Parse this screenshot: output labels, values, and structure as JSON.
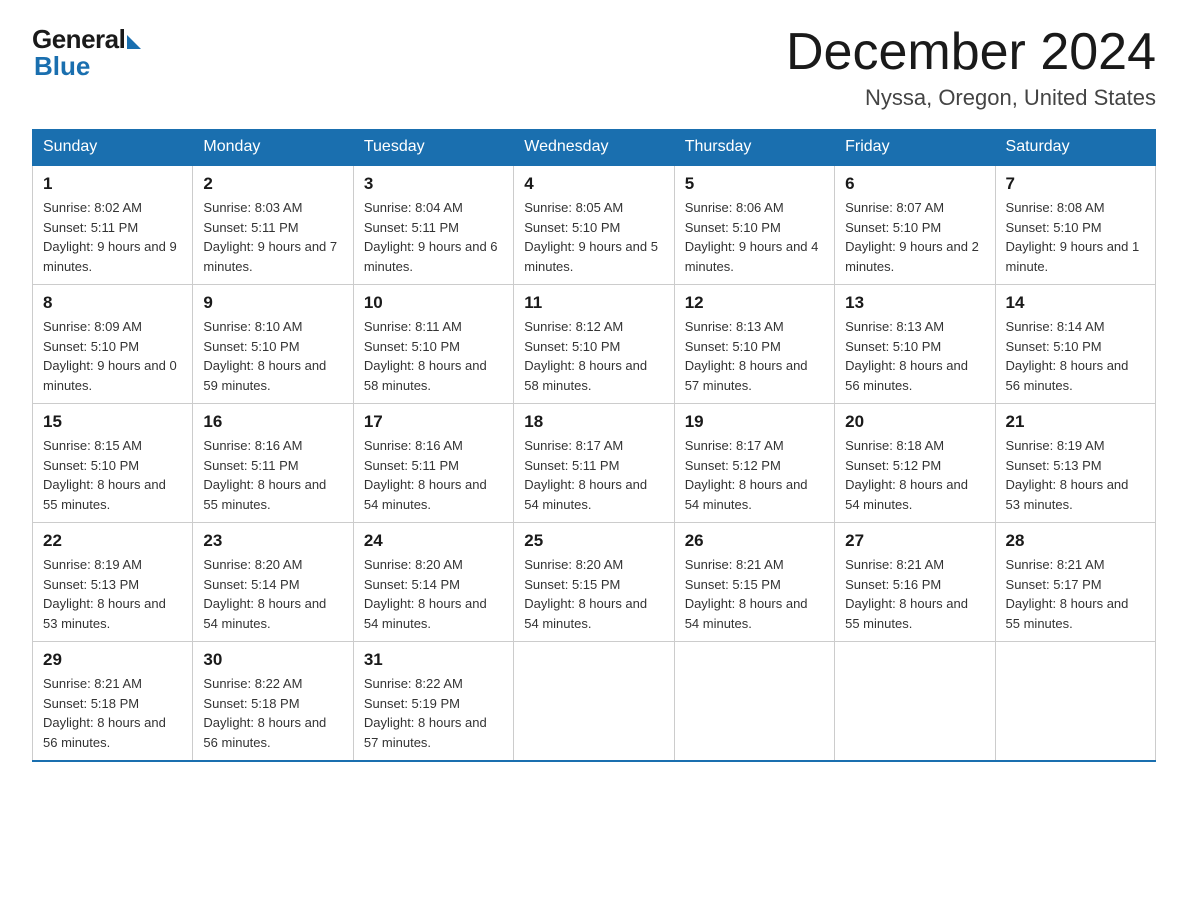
{
  "header": {
    "logo_general": "General",
    "logo_blue": "Blue",
    "month_title": "December 2024",
    "location": "Nyssa, Oregon, United States"
  },
  "days_of_week": [
    "Sunday",
    "Monday",
    "Tuesday",
    "Wednesday",
    "Thursday",
    "Friday",
    "Saturday"
  ],
  "weeks": [
    [
      {
        "day": "1",
        "sunrise": "8:02 AM",
        "sunset": "5:11 PM",
        "daylight": "9 hours and 9 minutes."
      },
      {
        "day": "2",
        "sunrise": "8:03 AM",
        "sunset": "5:11 PM",
        "daylight": "9 hours and 7 minutes."
      },
      {
        "day": "3",
        "sunrise": "8:04 AM",
        "sunset": "5:11 PM",
        "daylight": "9 hours and 6 minutes."
      },
      {
        "day": "4",
        "sunrise": "8:05 AM",
        "sunset": "5:10 PM",
        "daylight": "9 hours and 5 minutes."
      },
      {
        "day": "5",
        "sunrise": "8:06 AM",
        "sunset": "5:10 PM",
        "daylight": "9 hours and 4 minutes."
      },
      {
        "day": "6",
        "sunrise": "8:07 AM",
        "sunset": "5:10 PM",
        "daylight": "9 hours and 2 minutes."
      },
      {
        "day": "7",
        "sunrise": "8:08 AM",
        "sunset": "5:10 PM",
        "daylight": "9 hours and 1 minute."
      }
    ],
    [
      {
        "day": "8",
        "sunrise": "8:09 AM",
        "sunset": "5:10 PM",
        "daylight": "9 hours and 0 minutes."
      },
      {
        "day": "9",
        "sunrise": "8:10 AM",
        "sunset": "5:10 PM",
        "daylight": "8 hours and 59 minutes."
      },
      {
        "day": "10",
        "sunrise": "8:11 AM",
        "sunset": "5:10 PM",
        "daylight": "8 hours and 58 minutes."
      },
      {
        "day": "11",
        "sunrise": "8:12 AM",
        "sunset": "5:10 PM",
        "daylight": "8 hours and 58 minutes."
      },
      {
        "day": "12",
        "sunrise": "8:13 AM",
        "sunset": "5:10 PM",
        "daylight": "8 hours and 57 minutes."
      },
      {
        "day": "13",
        "sunrise": "8:13 AM",
        "sunset": "5:10 PM",
        "daylight": "8 hours and 56 minutes."
      },
      {
        "day": "14",
        "sunrise": "8:14 AM",
        "sunset": "5:10 PM",
        "daylight": "8 hours and 56 minutes."
      }
    ],
    [
      {
        "day": "15",
        "sunrise": "8:15 AM",
        "sunset": "5:10 PM",
        "daylight": "8 hours and 55 minutes."
      },
      {
        "day": "16",
        "sunrise": "8:16 AM",
        "sunset": "5:11 PM",
        "daylight": "8 hours and 55 minutes."
      },
      {
        "day": "17",
        "sunrise": "8:16 AM",
        "sunset": "5:11 PM",
        "daylight": "8 hours and 54 minutes."
      },
      {
        "day": "18",
        "sunrise": "8:17 AM",
        "sunset": "5:11 PM",
        "daylight": "8 hours and 54 minutes."
      },
      {
        "day": "19",
        "sunrise": "8:17 AM",
        "sunset": "5:12 PM",
        "daylight": "8 hours and 54 minutes."
      },
      {
        "day": "20",
        "sunrise": "8:18 AM",
        "sunset": "5:12 PM",
        "daylight": "8 hours and 54 minutes."
      },
      {
        "day": "21",
        "sunrise": "8:19 AM",
        "sunset": "5:13 PM",
        "daylight": "8 hours and 53 minutes."
      }
    ],
    [
      {
        "day": "22",
        "sunrise": "8:19 AM",
        "sunset": "5:13 PM",
        "daylight": "8 hours and 53 minutes."
      },
      {
        "day": "23",
        "sunrise": "8:20 AM",
        "sunset": "5:14 PM",
        "daylight": "8 hours and 54 minutes."
      },
      {
        "day": "24",
        "sunrise": "8:20 AM",
        "sunset": "5:14 PM",
        "daylight": "8 hours and 54 minutes."
      },
      {
        "day": "25",
        "sunrise": "8:20 AM",
        "sunset": "5:15 PM",
        "daylight": "8 hours and 54 minutes."
      },
      {
        "day": "26",
        "sunrise": "8:21 AM",
        "sunset": "5:15 PM",
        "daylight": "8 hours and 54 minutes."
      },
      {
        "day": "27",
        "sunrise": "8:21 AM",
        "sunset": "5:16 PM",
        "daylight": "8 hours and 55 minutes."
      },
      {
        "day": "28",
        "sunrise": "8:21 AM",
        "sunset": "5:17 PM",
        "daylight": "8 hours and 55 minutes."
      }
    ],
    [
      {
        "day": "29",
        "sunrise": "8:21 AM",
        "sunset": "5:18 PM",
        "daylight": "8 hours and 56 minutes."
      },
      {
        "day": "30",
        "sunrise": "8:22 AM",
        "sunset": "5:18 PM",
        "daylight": "8 hours and 56 minutes."
      },
      {
        "day": "31",
        "sunrise": "8:22 AM",
        "sunset": "5:19 PM",
        "daylight": "8 hours and 57 minutes."
      },
      null,
      null,
      null,
      null
    ]
  ]
}
